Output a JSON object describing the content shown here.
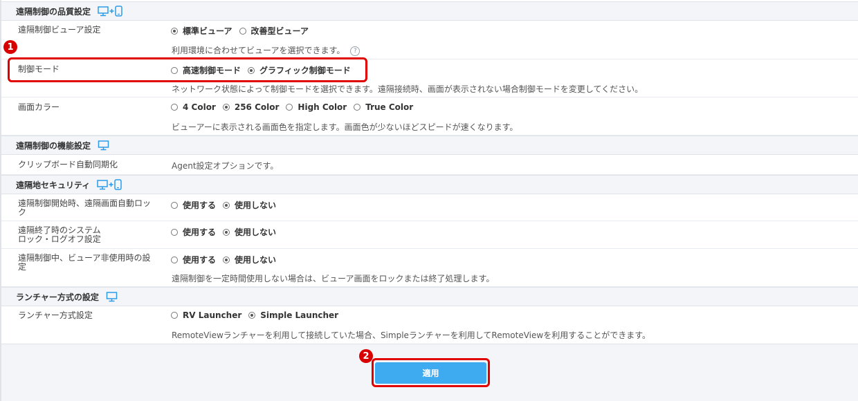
{
  "sections": {
    "quality": {
      "title": "遠隔制御の品質設定",
      "icon": "monitor-mobile-icon"
    },
    "function": {
      "title": "遠隔制御の機能設定",
      "icon": "monitor-icon"
    },
    "security": {
      "title": "遠隔地セキュリティ",
      "icon": "monitor-mobile-icon"
    },
    "launcher": {
      "title": "ランチャー方式の設定",
      "icon": "monitor-icon"
    }
  },
  "rows": {
    "viewer": {
      "label": "遠隔制御ビューア設定",
      "options": [
        "標準ビューア",
        "改善型ビューア"
      ],
      "selected": 0,
      "desc": "利用環境に合わせてビューアを選択できます。"
    },
    "mode": {
      "label": "制御モード",
      "options": [
        "高速制御モード",
        "グラフィック制御モード"
      ],
      "selected": 1,
      "desc": "ネットワーク状態によって制御モードを選択できます。遠隔接続時、画面が表示されない場合制御モードを変更してください。"
    },
    "color": {
      "label": "画面カラー",
      "options": [
        "4 Color",
        "256 Color",
        "High Color",
        "True Color"
      ],
      "selected": 1,
      "desc": "ビューアーに表示される画面色を指定します。画面色が少ないほどスピードが速くなります。"
    },
    "clipboard": {
      "label": "クリップボード自動同期化",
      "value": "Agent設定オプションです。"
    },
    "lock_start": {
      "label_line1": "遠隔制御開始時、遠隔画面自動ロッ",
      "label_line2": "ク",
      "options": [
        "使用する",
        "使用しない"
      ],
      "selected": 1
    },
    "lock_end": {
      "label_line1": "遠隔終了時のシステム",
      "label_line2": "ロック・ログオフ設定",
      "options": [
        "使用する",
        "使用しない"
      ],
      "selected": 1
    },
    "idle": {
      "label_line1": "遠隔制御中、ビューア非使用時の設",
      "label_line2": "定",
      "options": [
        "使用する",
        "使用しない"
      ],
      "selected": 1,
      "desc": "遠隔制御を一定時間使用しない場合は、ビューア画面をロックまたは終了処理します。"
    },
    "launcher": {
      "label": "ランチャー方式設定",
      "options": [
        "RV Launcher",
        "Simple Launcher"
      ],
      "selected": 1,
      "desc": "RemoteViewランチャーを利用して接続していた場合、Simpleランチャーを利用してRemoteViewを利用することができます。"
    }
  },
  "help_glyph": "?",
  "markers": [
    "1",
    "2"
  ],
  "apply_label": "適用",
  "colors": {
    "accent": "#3eaaf0",
    "highlight": "#e10000",
    "icon": "#2b9be8"
  }
}
